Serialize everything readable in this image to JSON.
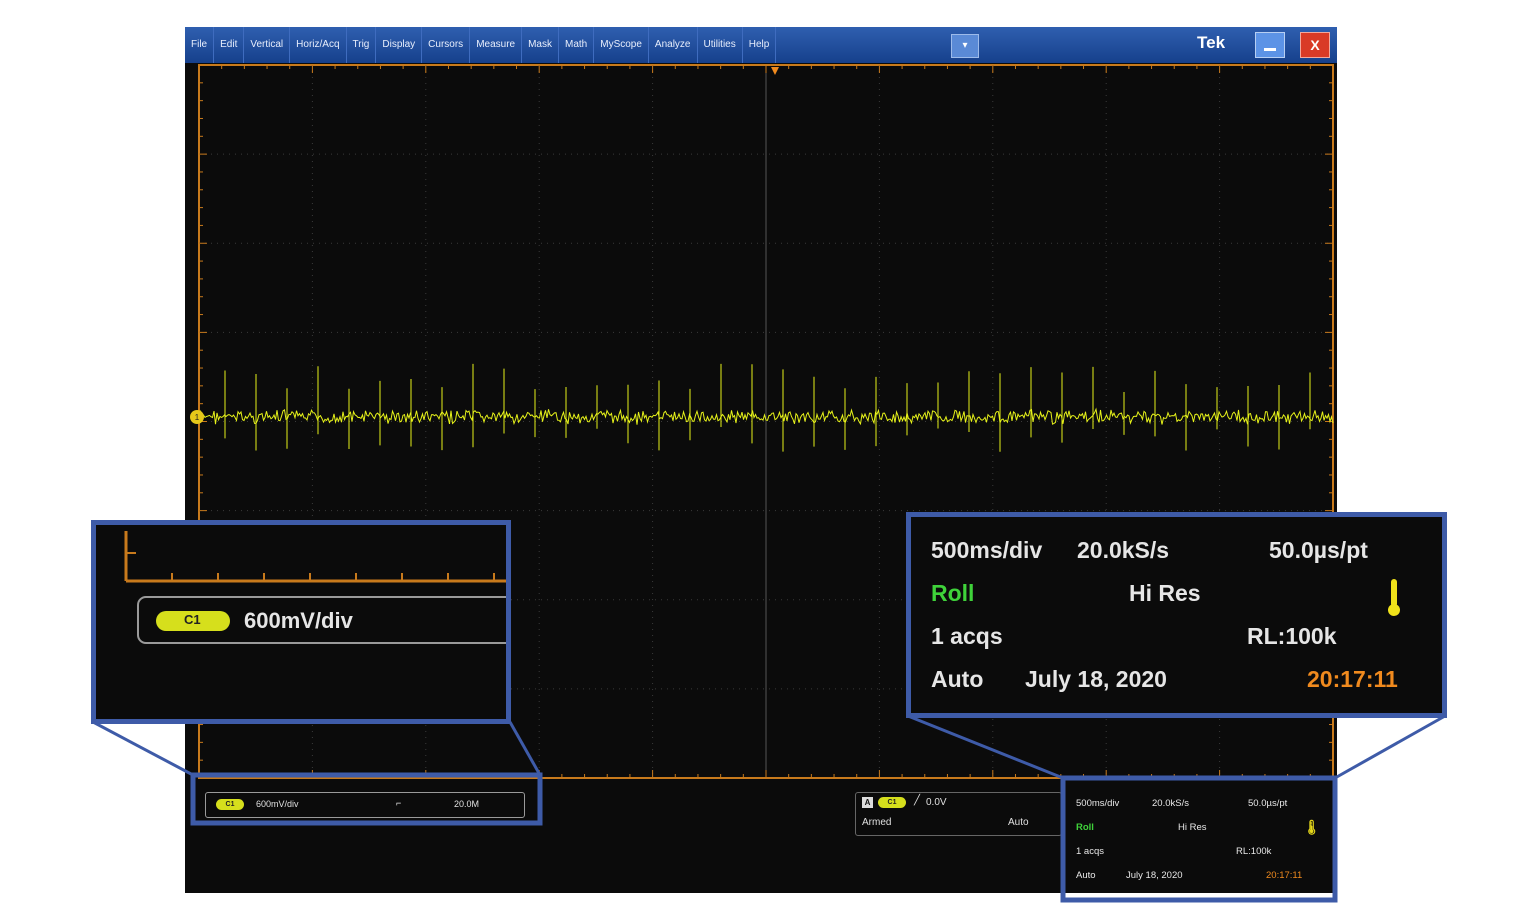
{
  "menubar": {
    "items": [
      "File",
      "Edit",
      "Vertical",
      "Horiz/Acq",
      "Trig",
      "Display",
      "Cursors",
      "Measure",
      "Mask",
      "Math",
      "MyScope",
      "Analyze",
      "Utilities",
      "Help"
    ],
    "dropdown_glyph": "▾",
    "brand": "Tek",
    "close_glyph": "X"
  },
  "channel": {
    "badge": "C1",
    "scale": "600mV/div",
    "bandwidth": "20.0M",
    "marker": "1"
  },
  "trigger": {
    "mode_badge": "A",
    "source_badge": "C1",
    "level": "0.0V",
    "state": "Armed",
    "mode": "Auto"
  },
  "acquisition": {
    "timebase": "500ms/div",
    "sample_rate": "20.0kS/s",
    "resolution": "50.0µs/pt",
    "mode": "Roll",
    "acq_type": "Hi Res",
    "acqs": "1 acqs",
    "record_length": "RL:100k",
    "trigger_mode": "Auto",
    "date": "July 18, 2020",
    "time": "20:17:11"
  },
  "colors": {
    "trace": "#e6f21a",
    "frame": "#c87a1c",
    "menubar": "#1f4e9e",
    "callout_border": "#3e5ba8",
    "roll_green": "#3fd23a",
    "time_orange": "#f08a1e",
    "badge_yellow": "#d6df1c"
  },
  "icons": [
    "trigger-position-icon",
    "ground-marker-icon",
    "thermometer-icon",
    "minimize-icon",
    "close-icon",
    "trigger-slope-icon",
    "bandwidth-limit-icon"
  ]
}
